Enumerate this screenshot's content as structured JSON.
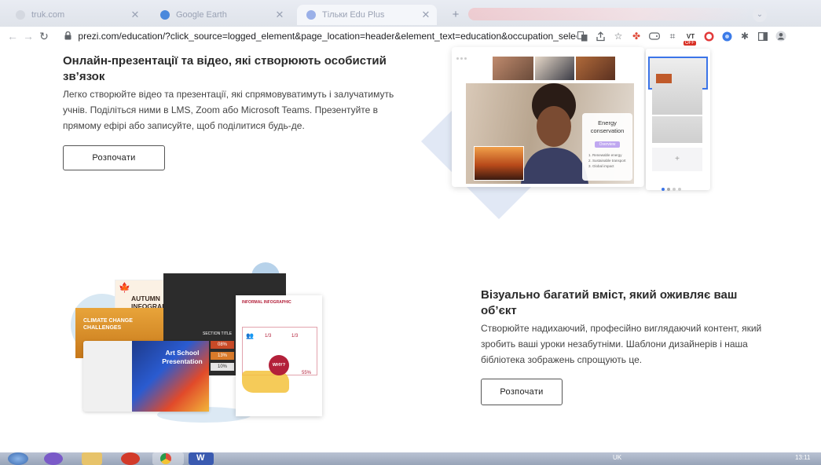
{
  "browser": {
    "tabs": [
      {
        "title": "truk.com",
        "color": "#c7ccd6"
      },
      {
        "title": "Google Earth",
        "color": "#4a89dc"
      },
      {
        "title": "Тільки Edu Plus",
        "color": "#9ab0e8"
      }
    ],
    "new_tab": "+",
    "url": "prezi.com/education/?click_source=logged_element&page_location=header&element_text=education&occupation_selector=t...",
    "ext_badge": "OFF"
  },
  "section1": {
    "title": "Онлайн-презентації та відео, які створюють особистий зв’язок",
    "body": "Легко створюйте відео та презентації, які спрямовуватимуть і залучатимуть учнів. Поділіться ними в LMS, Zoom або Microsoft Teams. Презентуйте в прямому ефірі або записуйте, щоб поділитися будь-де.",
    "cta": "Розпочати",
    "mock": {
      "card_title": "Energy conservation",
      "card_chip": "Overview",
      "card_items": [
        "1. Renewable energy",
        "2. Sustainable transport",
        "3. Global impact"
      ],
      "add": "+"
    }
  },
  "section2": {
    "title": "Візуально багатий вміст, який оживляє ваш об’єкт",
    "body": "Створюйте надихаючий, професійно виглядаючий контент, який зробить ваші уроки незабутніми. Шаблони дизайнерів і наша бібліотека зображень спрощують це.",
    "cta": "Розпочати",
    "collage": {
      "autumn": "AUTUMN INFOGRAPHIC",
      "climate": "CLIMATE CHANGE CHALLENGES",
      "art": "Art School Presentation",
      "section_title": "SECTION TITLE",
      "stats": [
        "08%",
        "13%",
        "10%"
      ],
      "info_title": "INFORMAL INFOGRAPHIC",
      "ratio_a": "1/3",
      "ratio_b": "1/3",
      "why": "WHY?",
      "pct": "55%"
    }
  },
  "taskbar": {
    "lang": "UK",
    "time": "13:11"
  }
}
